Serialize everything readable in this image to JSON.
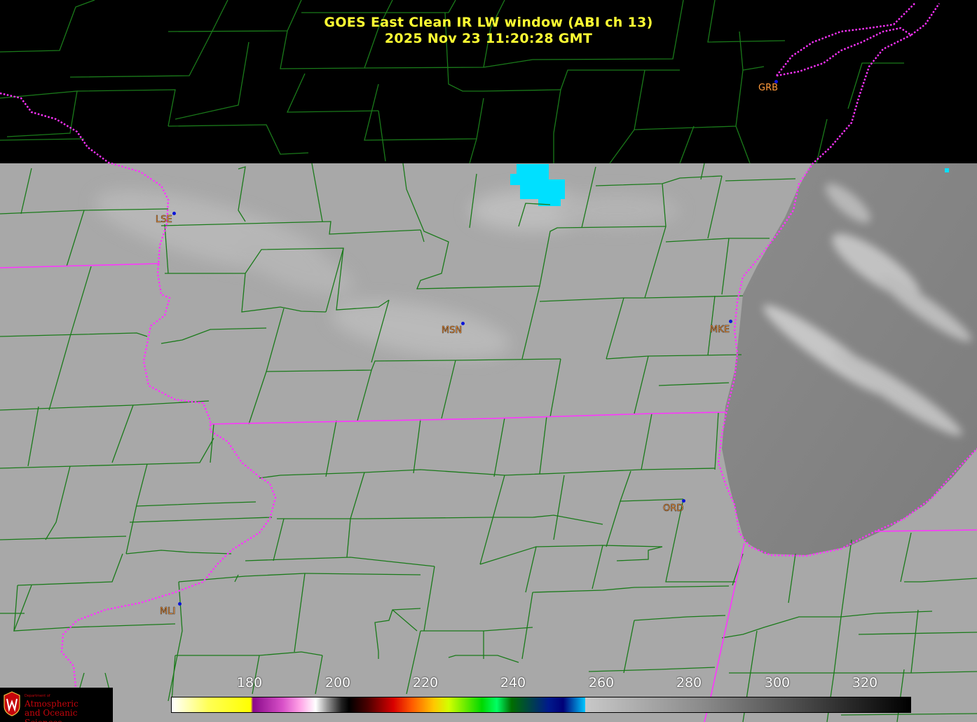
{
  "title": {
    "line1": "GOES East Clean IR LW window (ABI ch 13)",
    "line2": "2025 Nov 23  11:20:28 GMT"
  },
  "stations": [
    {
      "id": "GRB"
    },
    {
      "id": "LSE"
    },
    {
      "id": "MSN"
    },
    {
      "id": "MKE"
    },
    {
      "id": "ORD"
    },
    {
      "id": "MLI"
    }
  ],
  "colorbar": {
    "ticks": [
      "180",
      "200",
      "220",
      "240",
      "260",
      "280",
      "300",
      "320"
    ]
  },
  "logo": {
    "small": "Department of",
    "line1": "Atmospheric",
    "line2": "and Oceanic Sciences"
  },
  "colors": {
    "title": "#ffff33",
    "county_lines": "#1a7a1a",
    "state_lines": "#ff33ff",
    "station_dot": "#0a14d8",
    "station_label": "#ff9a3c",
    "cloud_cyan": "#00e5ff"
  }
}
